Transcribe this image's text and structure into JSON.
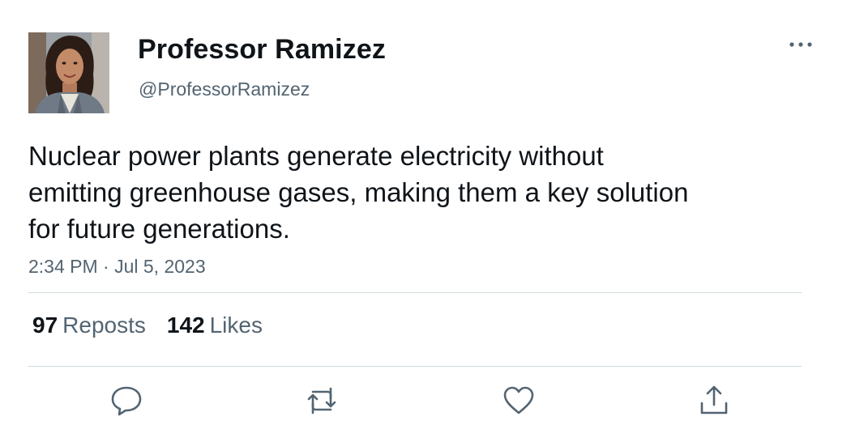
{
  "author": {
    "display_name": "Professor Ramizez",
    "handle": "@ProfessorRamizez",
    "avatar_icon": "profile-photo"
  },
  "tweet": {
    "text_lines": [
      "Nuclear power plants generate electricity without",
      "emitting greenhouse gases, making them a key solution",
      "for future generations."
    ],
    "timestamp": "2:34 PM · Jul 5, 2023"
  },
  "stats": {
    "reposts_count": "97",
    "reposts_label": "Reposts",
    "likes_count": "142",
    "likes_label": "Likes"
  },
  "actions": {
    "reply_icon": "reply-icon",
    "repost_icon": "repost-icon",
    "like_icon": "heart-icon",
    "share_icon": "share-icon",
    "more_icon": "more-options-icon"
  },
  "colors": {
    "primary_text": "#0f1419",
    "secondary_text": "#536471",
    "divider": "#cfd9de",
    "icon": "#536471"
  }
}
